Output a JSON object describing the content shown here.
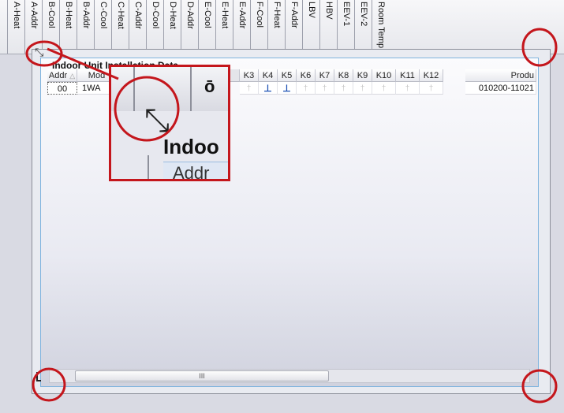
{
  "top_columns": [
    "A-Heat",
    "A-Addr",
    "B-Cool",
    "B-Heat",
    "B-Addr",
    "C-Cool",
    "C-Heat",
    "C-Addr",
    "D-Cool",
    "D-Heat",
    "D-Addr",
    "E-Cool",
    "E-Heat",
    "E-Addr",
    "F-Cool",
    "F-Heat",
    "F-Addr",
    "LBV",
    "HBV",
    "EEV-1",
    "EEV-2",
    "Room Temp."
  ],
  "grid": {
    "title": "Indoor Unit Installation Data",
    "left_headers": [
      "Addr",
      "Mod"
    ],
    "k_headers": [
      "K3",
      "K4",
      "K5",
      "K6",
      "K7",
      "K8",
      "K9",
      "K10",
      "K11",
      "K12"
    ],
    "last_header": "Produ",
    "row": {
      "addr": "00",
      "model": "1WA",
      "k_values": [
        false,
        true,
        true,
        false,
        false,
        false,
        false,
        false,
        false,
        false
      ],
      "product": "010200-11021"
    }
  },
  "zoom": {
    "title_text": "Indoo",
    "addr_text": "Addr"
  },
  "scroll": {
    "thumb_glyph": "III"
  },
  "colors": {
    "annotation": "#c4161c",
    "accent": "#7fb3de",
    "pin_on": "#1b4fb3"
  },
  "icons": {
    "resize": "diagonal-resize-icon",
    "pin": "pushpin-icon"
  }
}
